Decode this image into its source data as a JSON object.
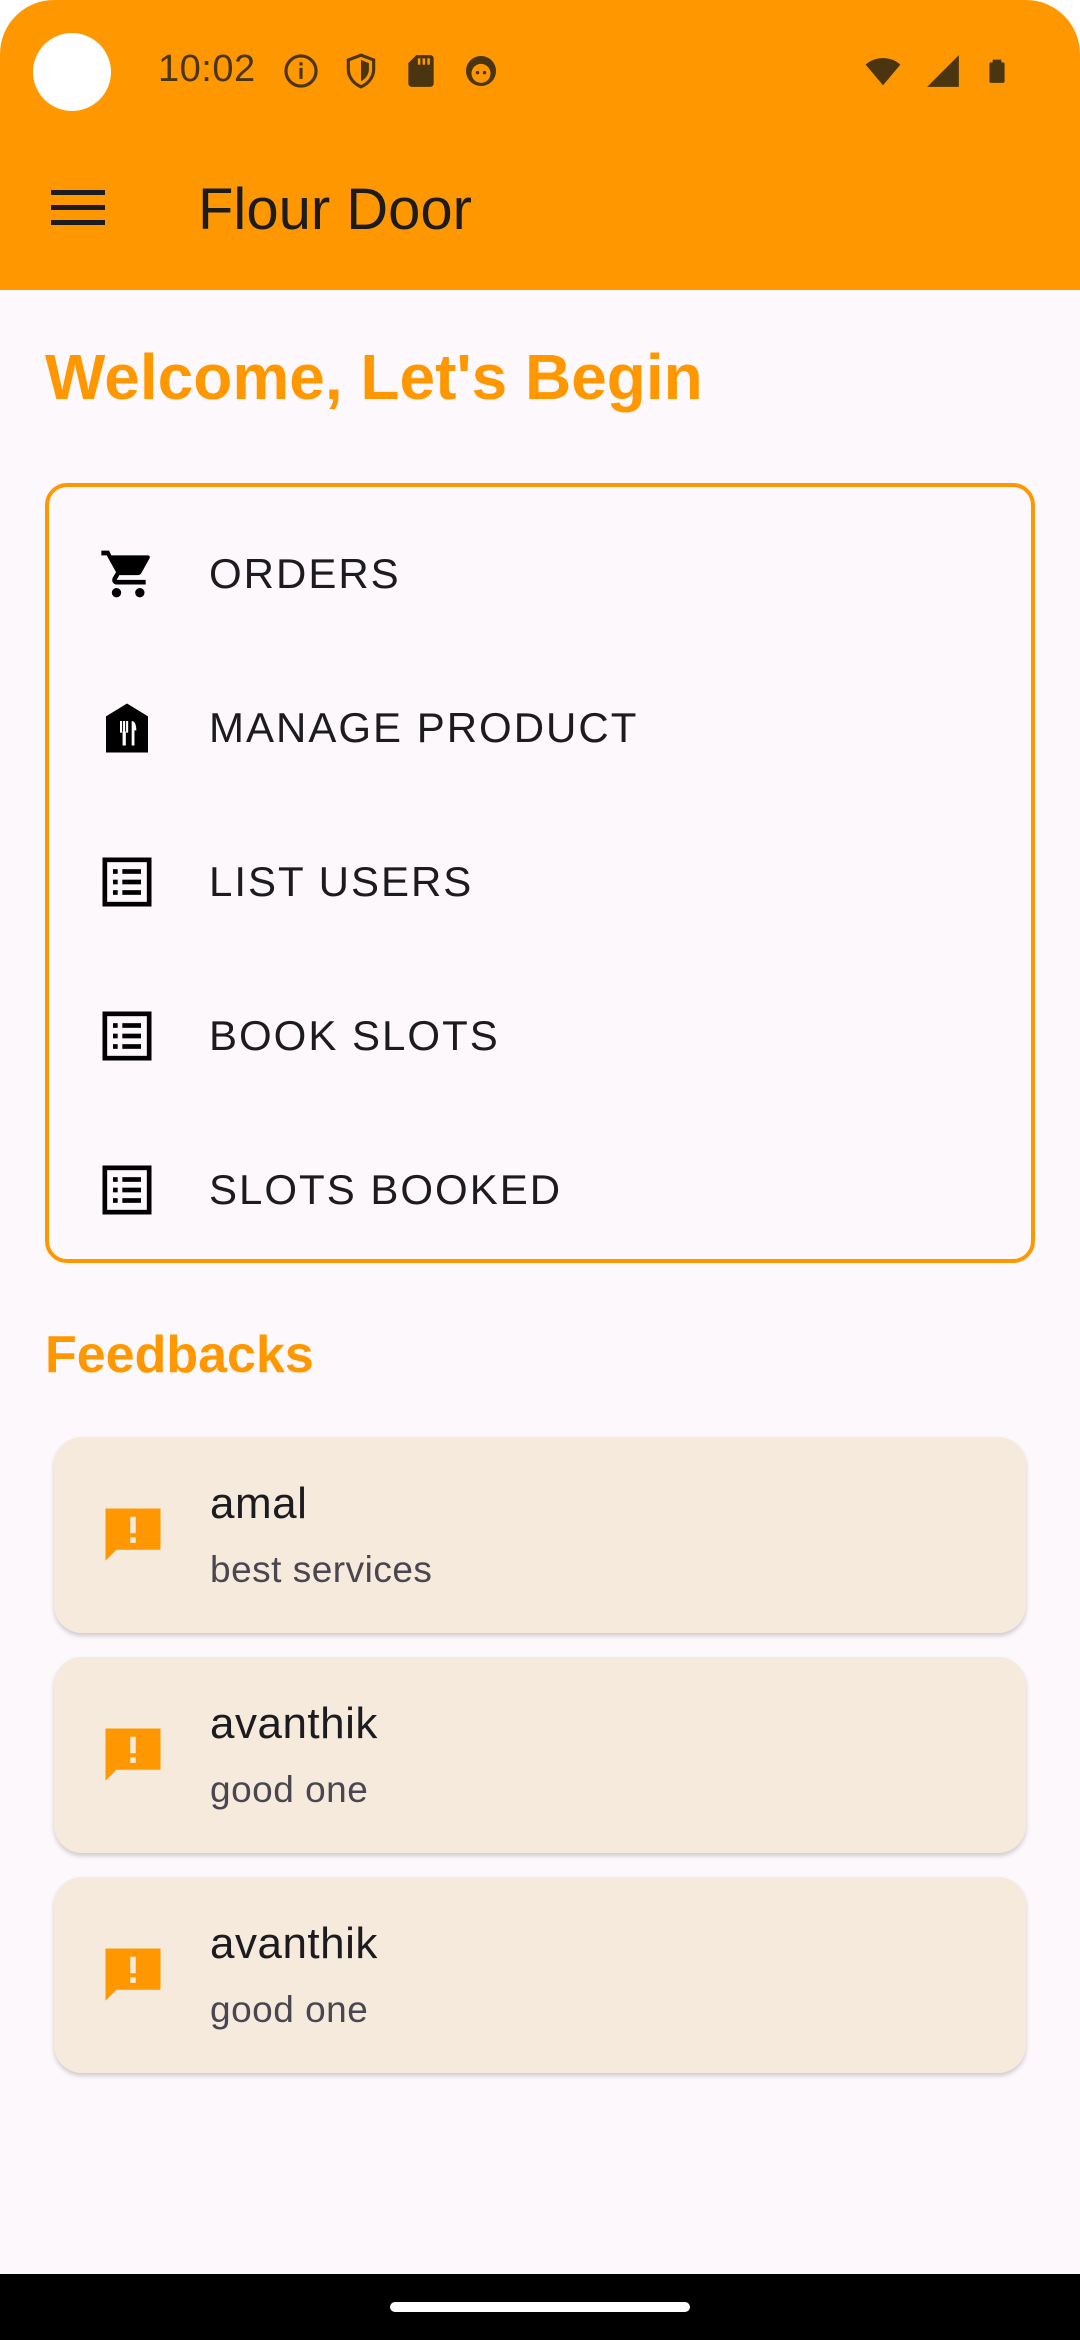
{
  "status_bar": {
    "time": "10:02",
    "left_icons": [
      "info-icon",
      "shield-icon",
      "sd-card-icon",
      "face-icon"
    ],
    "right_icons": [
      "wifi-icon",
      "signal-icon",
      "battery-icon"
    ]
  },
  "app_bar": {
    "title": "Flour Door",
    "menu_icon": "hamburger-menu-icon"
  },
  "welcome": "Welcome, Let's Begin",
  "menu": {
    "items": [
      {
        "label": "ORDERS",
        "icon": "cart-icon"
      },
      {
        "label": "MANAGE PRODUCT",
        "icon": "store-food-icon"
      },
      {
        "label": "LIST USERS",
        "icon": "list-icon"
      },
      {
        "label": "BOOK SLOTS",
        "icon": "list-icon"
      },
      {
        "label": "SLOTS BOOKED",
        "icon": "list-icon"
      }
    ]
  },
  "feedbacks": {
    "heading": "Feedbacks",
    "items": [
      {
        "name": "amal",
        "message": "best services",
        "icon": "feedback-icon"
      },
      {
        "name": "avanthik",
        "message": "good one",
        "icon": "feedback-icon"
      },
      {
        "name": "avanthik",
        "message": "good one",
        "icon": "feedback-icon"
      }
    ]
  },
  "colors": {
    "accent": "#ff9800",
    "card_background": "#f6eadd",
    "page_background": "#fdf8fb"
  }
}
